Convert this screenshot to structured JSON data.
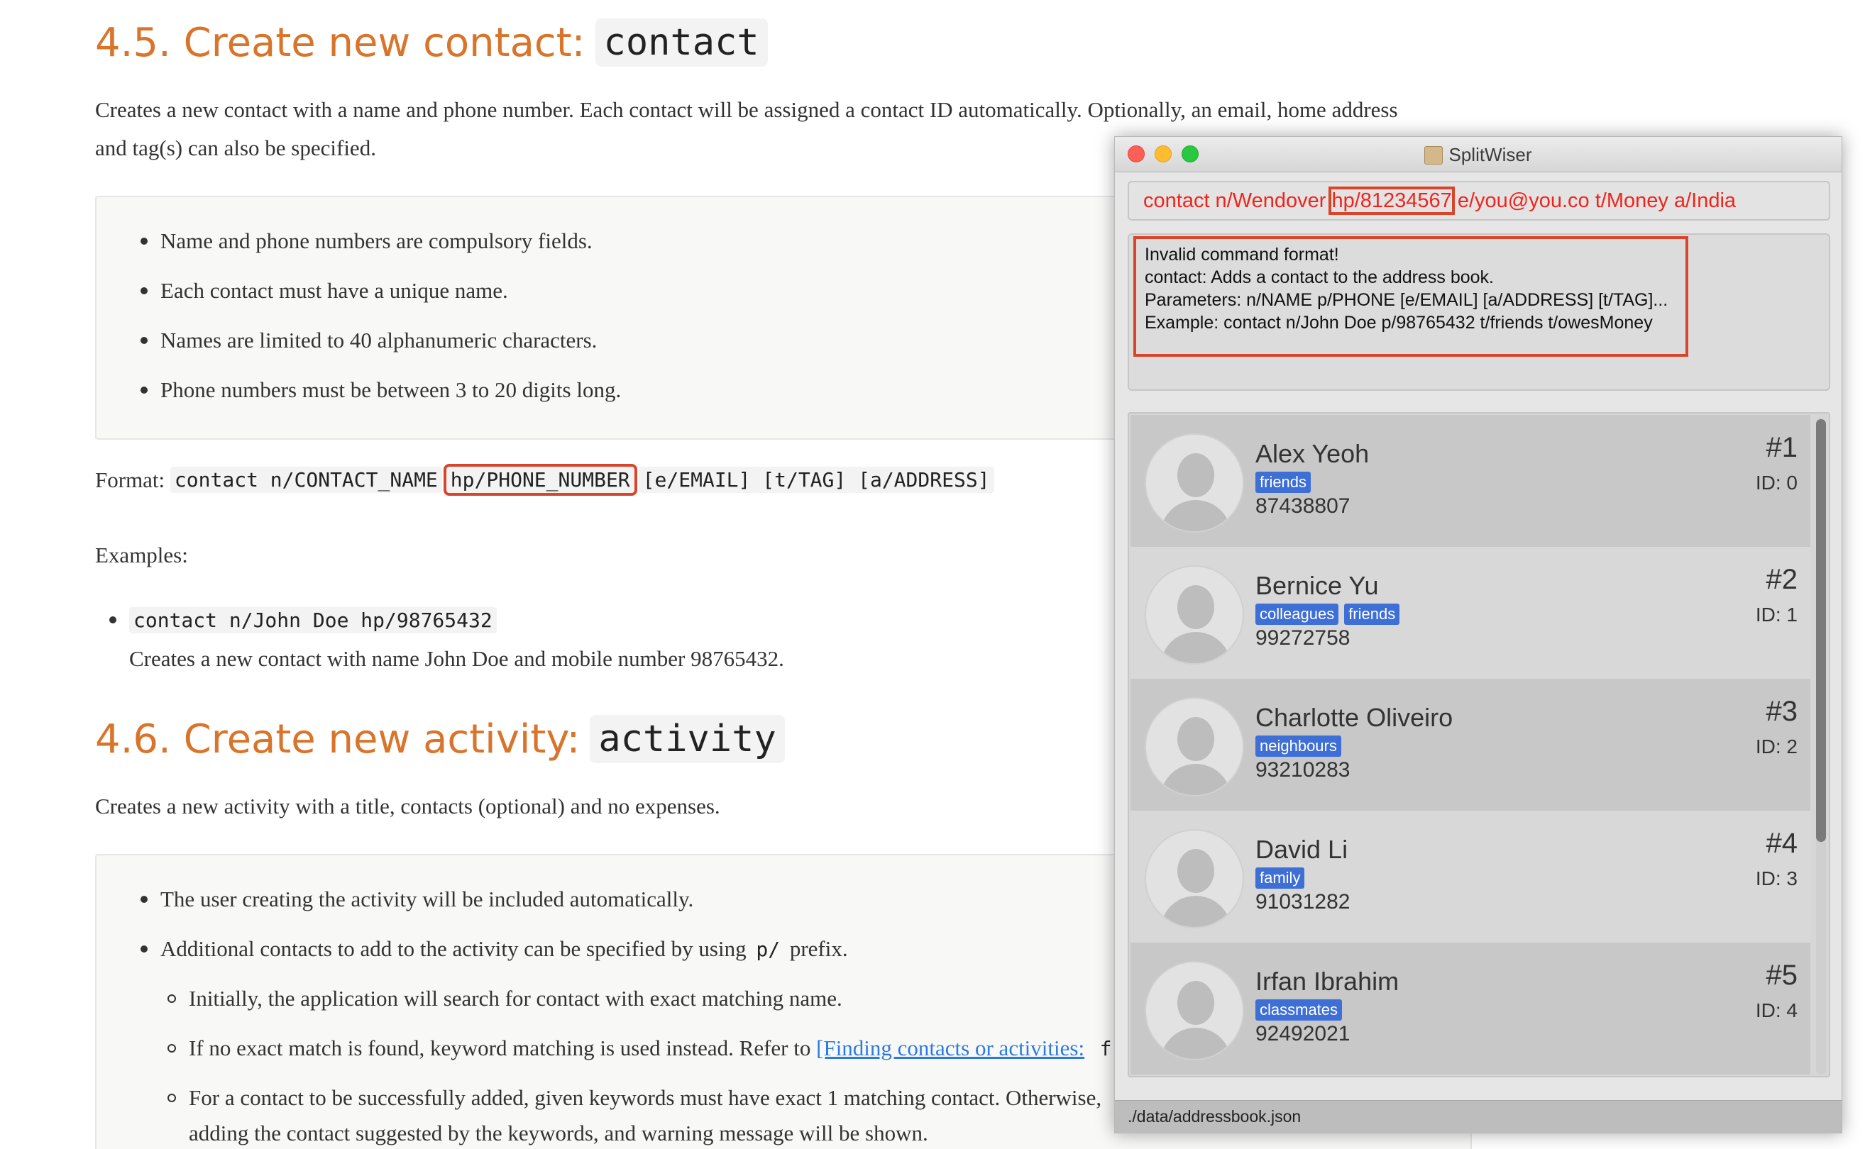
{
  "doc": {
    "section1": {
      "number": "4.5.",
      "title": "Create new contact:",
      "code": "contact"
    },
    "intro1": "Creates a new contact with a name and phone number. Each contact will be assigned a contact ID automatically. Optionally, an email, home address and tag(s) can also be specified.",
    "notes1": [
      "Name and phone numbers are compulsory fields.",
      "Each contact must have a unique name.",
      "Names are limited to 40 alphanumeric characters.",
      "Phone numbers must be between 3 to 20 digits long."
    ],
    "format_label": "Format:",
    "format_part1": "contact n/CONTACT_NAME",
    "format_part2": "hp/PHONE_NUMBER",
    "format_part3": "[e/EMAIL] [t/TAG] [a/ADDRESS]",
    "examples_label": "Examples:",
    "example_code": "contact n/John Doe hp/98765432",
    "example_desc": "Creates a new contact with name John Doe and mobile number 98765432.",
    "section2": {
      "number": "4.6.",
      "title": "Create new activity:",
      "code": "activity"
    },
    "intro2": "Creates a new activity with a title, contacts (optional) and no expenses.",
    "notes2_1": "The user creating the activity will be included automatically.",
    "notes2_2_pre": "Additional contacts to add to the activity can be specified by using",
    "notes2_2_code": "p/",
    "notes2_2_post": "prefix.",
    "sub1": "Initially, the application will search for contact with exact matching name.",
    "sub2_pre": "If no exact match is found, keyword matching is used instead. Refer to",
    "sub2_link": "[Finding contacts or activities:",
    "sub2_code": "f",
    "sub3_line1": "For a contact to be successfully added, given keywords must have exact 1 matching contact. Otherwise,",
    "sub3_line2": "adding the contact suggested by the keywords, and warning message will be shown."
  },
  "window": {
    "title": "SplitWiser",
    "command_before": "contact n/Wendover ",
    "command_highlight": "hp/81234567",
    "command_after": " e/you@you.co t/Money a/India",
    "result_lines": [
      "Invalid command format!",
      "contact: Adds a contact to the address book.",
      "Parameters: n/NAME p/PHONE [e/EMAIL] [a/ADDRESS] [t/TAG]...",
      "Example: contact n/John Doe p/98765432 t/friends t/owesMoney"
    ],
    "contacts": [
      {
        "name": "Alex Yeoh",
        "tags": [
          "friends"
        ],
        "phone": "87438807",
        "index": "#1",
        "id": "ID: 0"
      },
      {
        "name": "Bernice Yu",
        "tags": [
          "colleagues",
          "friends"
        ],
        "phone": "99272758",
        "index": "#2",
        "id": "ID: 1"
      },
      {
        "name": "Charlotte Oliveiro",
        "tags": [
          "neighbours"
        ],
        "phone": "93210283",
        "index": "#3",
        "id": "ID: 2"
      },
      {
        "name": "David Li",
        "tags": [
          "family"
        ],
        "phone": "91031282",
        "index": "#4",
        "id": "ID: 3"
      },
      {
        "name": "Irfan Ibrahim",
        "tags": [
          "classmates"
        ],
        "phone": "92492021",
        "index": "#5",
        "id": "ID: 4"
      }
    ],
    "status_path": "./data/addressbook.json"
  },
  "colors": {
    "heading": "#d9742b",
    "highlight_box": "#d9452b",
    "command_text": "#f0241b",
    "tag_bg": "#3e6fd6"
  }
}
